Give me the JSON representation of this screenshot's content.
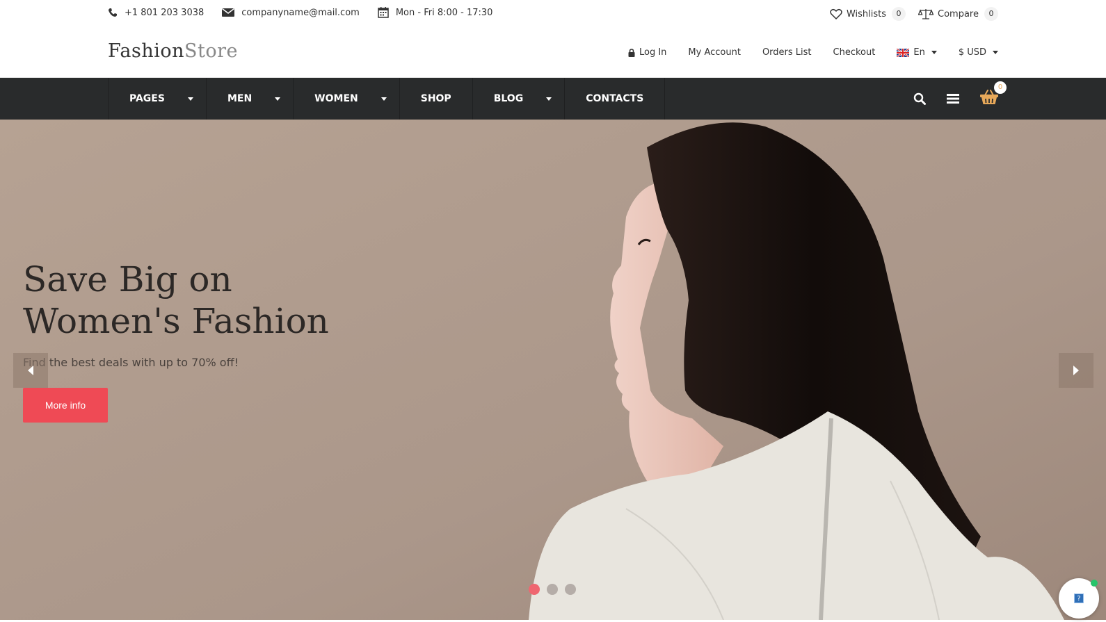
{
  "topbar": {
    "phone": "+1 801 203 3038",
    "email": "companyname@mail.com",
    "hours": "Mon - Fri 8:00 - 17:30",
    "wishlists_label": "Wishlists",
    "wishlists_count": "0",
    "compare_label": "Compare",
    "compare_count": "0"
  },
  "header": {
    "logo_part1": "Fashion",
    "logo_part2": "Store",
    "login": "Log In",
    "my_account": "My Account",
    "orders_list": "Orders List",
    "checkout": "Checkout",
    "language": "En",
    "currency": "$ USD"
  },
  "nav": {
    "items": [
      {
        "label": "PAGES"
      },
      {
        "label": "MEN"
      },
      {
        "label": "WOMEN"
      },
      {
        "label": "SHOP"
      },
      {
        "label": "BLOG"
      },
      {
        "label": "CONTACTS"
      }
    ],
    "cart_count": "0"
  },
  "hero": {
    "title": "Save Big on Women's Fashion",
    "subtitle": "Find the best deals with up to 70% off!",
    "button": "More info",
    "active_slide": 1,
    "slide_count": 3
  },
  "help_widget": {
    "icon_text": "?"
  },
  "colors": {
    "accent": "#ef4a55",
    "navbar": "#292b2c",
    "cart": "#e8a95a",
    "online": "#27c46a"
  }
}
